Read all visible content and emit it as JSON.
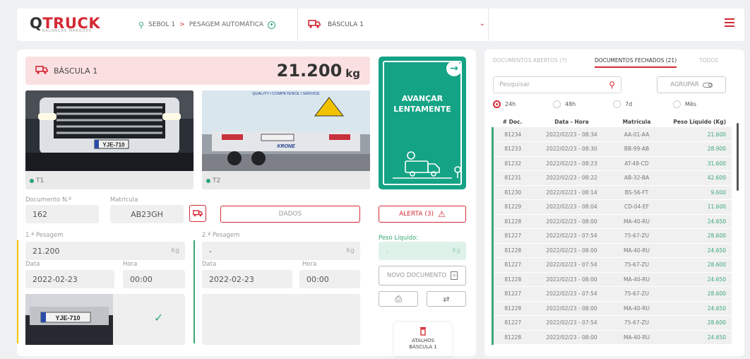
{
  "header": {
    "brand": "TRUCK",
    "brand_q": "Q",
    "tagline": "BALANÇAS MARQUES",
    "breadcrumb": [
      "SEBOL 1",
      "PESAGEM AUTOMÁTICA"
    ],
    "breadcrumb_sep": ">",
    "scale_selected": "BÁSCULA 1"
  },
  "scale": {
    "name": "BÁSCULA 1",
    "weight": "21.200",
    "unit": "kg"
  },
  "cameras": [
    {
      "label": "T1",
      "plate": "YJE-710"
    },
    {
      "label": "T2",
      "banner": "QUALITY I COMPETENCE I SERVICE",
      "logo": "KRONE"
    }
  ],
  "advance": {
    "line1": "AVANÇAR",
    "line2": "LENTAMENTE"
  },
  "form": {
    "doc_label": "Documento N.º",
    "doc_value": "162",
    "plate_label": "Matrícula",
    "plate_value": "AB23GH",
    "dados": "DADOS",
    "alert": "ALERTA (3)",
    "first_label": "1.ª Pesagem",
    "first_value": "21.200",
    "first_unit": "Kg",
    "second_label": "2.ª Pesagem",
    "second_value": "-",
    "second_unit": "Kg",
    "net_label": "Peso Líquido:",
    "net_value": "-",
    "net_unit": "Kg",
    "date_label": "Data",
    "hour_label": "Hora",
    "first_date": "2022-02-23",
    "first_hour": "00:00",
    "second_date": "2022-02-23",
    "second_hour": "00:00",
    "new_doc": "NOVO DOCUMENTO",
    "thumb_plate": "YJE-710",
    "check": "✓"
  },
  "shortcuts": {
    "line1": "ATALHOS",
    "line2": "BÁSCULA 1"
  },
  "docs_panel": {
    "tabs": [
      "DOCUMENTOS ABERTOS (7)",
      "DOCUMENTOS FECHADOS (21)",
      "TODOS"
    ],
    "active_tab": 1,
    "search_placeholder": "Pesquisar",
    "group": "AGRUPAR",
    "periods": [
      "24h",
      "48h",
      "7d",
      "Mês"
    ],
    "selected_period": 0,
    "columns": [
      "# Doc.",
      "Data - Hora",
      "Matrícula",
      "Peso Líquido (Kg)"
    ],
    "rows": [
      [
        "81234",
        "2022/02/23 - 08:34",
        "AA-01-AA",
        "21.600"
      ],
      [
        "81233",
        "2022/02/23 - 08:30",
        "BB-99-AB",
        "28.900"
      ],
      [
        "81232",
        "2022/02/23 - 08:23",
        "AT-48-CD",
        "31.600"
      ],
      [
        "81231",
        "2022/02/23 - 08:22",
        "AB-32-BA",
        "42.600"
      ],
      [
        "81230",
        "2022/02/23 - 08:14",
        "BS-56-FT",
        "9.600"
      ],
      [
        "81229",
        "2022/02/23 - 08:04",
        "CD-04-EF",
        "11.600"
      ],
      [
        "81228",
        "2022/02/23 - 08:00",
        "MA-40-RU",
        "24.650"
      ],
      [
        "81227",
        "2022/02/23 - 07:54",
        "75-67-ZU",
        "28.600"
      ],
      [
        "81228",
        "2022/02/23 - 08:00",
        "MA-40-RU",
        "24.650"
      ],
      [
        "81227",
        "2022/02/23 - 07:54",
        "75-67-ZU",
        "28.600"
      ],
      [
        "81228",
        "2022/02/23 - 08:00",
        "MA-40-RU",
        "24.650"
      ],
      [
        "81227",
        "2022/02/23 - 07:54",
        "75-67-ZU",
        "28.600"
      ],
      [
        "81228",
        "2022/02/23 - 08:00",
        "MA-40-RU",
        "24.650"
      ],
      [
        "81227",
        "2022/02/23 - 07:54",
        "75-67-ZU",
        "28.600"
      ],
      [
        "81228",
        "2022/02/23 - 08:00",
        "MA-40-RU",
        "24.650"
      ]
    ]
  },
  "colors": {
    "accent": "#d42a35",
    "green": "#14a385",
    "pink": "#fbe0e2"
  }
}
